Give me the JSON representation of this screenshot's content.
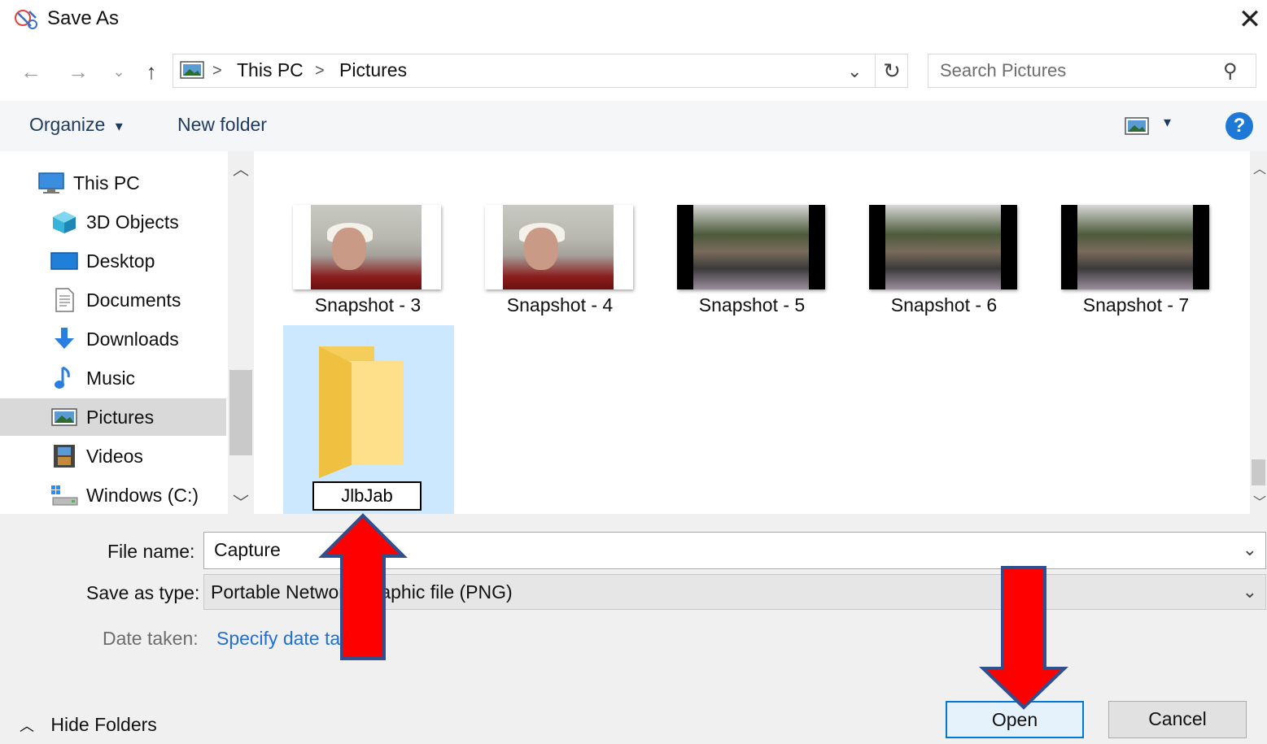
{
  "window": {
    "title": "Save As",
    "close_glyph": "✕"
  },
  "nav": {
    "back_glyph": "←",
    "forward_glyph": "→",
    "recent_glyph": "⌄",
    "up_glyph": "↑",
    "breadcrumb": [
      "This PC",
      "Pictures"
    ],
    "crumb_separator": ">",
    "dropdown_glyph": "⌄",
    "refresh_glyph": "↻",
    "search_placeholder": "Search Pictures",
    "search_glyph": "⚲"
  },
  "toolbar": {
    "organize_label": "Organize",
    "organize_glyph": "▾",
    "new_folder_label": "New folder",
    "view_dropdown_glyph": "▾",
    "help_glyph": "?"
  },
  "sidebar": {
    "items": [
      {
        "label": "This PC",
        "icon": "computer-icon"
      },
      {
        "label": "3D Objects",
        "icon": "cube-icon"
      },
      {
        "label": "Desktop",
        "icon": "desktop-icon"
      },
      {
        "label": "Documents",
        "icon": "document-icon"
      },
      {
        "label": "Downloads",
        "icon": "download-icon"
      },
      {
        "label": "Music",
        "icon": "music-note-icon"
      },
      {
        "label": "Pictures",
        "icon": "pictures-icon",
        "selected": true
      },
      {
        "label": "Videos",
        "icon": "film-icon"
      },
      {
        "label": "Windows (C:)",
        "icon": "drive-icon"
      }
    ],
    "scroll_up_glyph": "︿",
    "scroll_down_glyph": "﹀"
  },
  "files": [
    {
      "name": "Snapshot - 3",
      "kind": "photo-portrait"
    },
    {
      "name": "Snapshot - 4",
      "kind": "photo-portrait"
    },
    {
      "name": "Snapshot - 5",
      "kind": "photo-street"
    },
    {
      "name": "Snapshot - 6",
      "kind": "photo-street"
    },
    {
      "name": "Snapshot - 7",
      "kind": "photo-street"
    }
  ],
  "new_folder": {
    "rename_value": "JlbJab"
  },
  "form": {
    "file_name_label": "File name:",
    "file_name_value": "Capture",
    "save_type_label": "Save as type:",
    "save_type_value": "Portable Network Graphic file (PNG)",
    "date_taken_label": "Date taken:",
    "date_taken_link": "Specify date taken",
    "combo_glyph": "⌄"
  },
  "footer": {
    "hide_folders_glyph": "︿",
    "hide_folders_label": "Hide Folders",
    "open_label": "Open",
    "cancel_label": "Cancel"
  },
  "colors": {
    "accent": "#0078d7",
    "selected_bg": "#cce8ff",
    "annotation_arrow": "#ff0000",
    "annotation_arrow_outline": "#2f4f8f"
  }
}
